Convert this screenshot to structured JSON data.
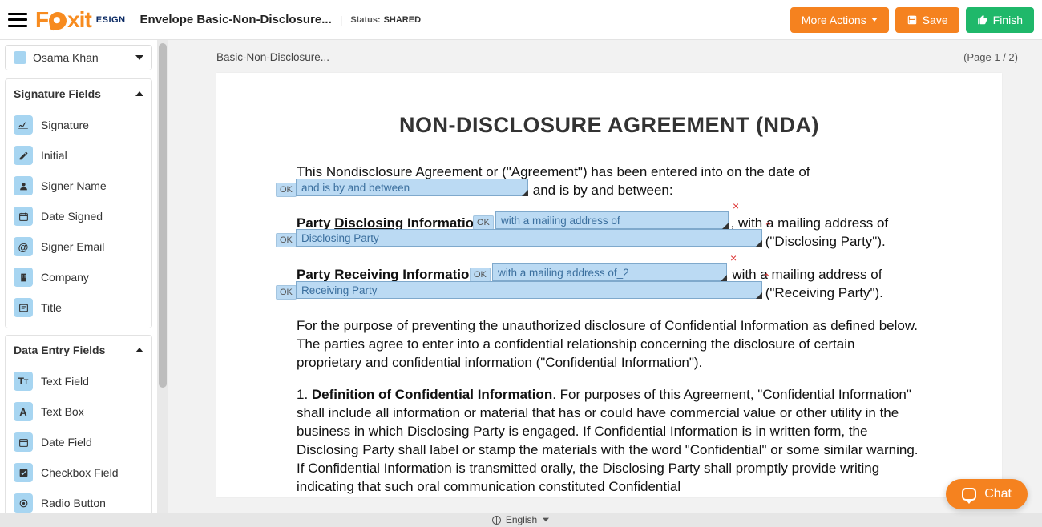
{
  "header": {
    "brand_main": "Foxit",
    "brand_sub": "ESIGN",
    "envelope_title": "Envelope Basic-Non-Disclosure...",
    "status_label": "Status:",
    "status_value": "SHARED",
    "more_actions": "More Actions",
    "save": "Save",
    "finish": "Finish"
  },
  "signer": {
    "name": "Osama Khan"
  },
  "panels": {
    "signature": {
      "title": "Signature Fields",
      "items": [
        {
          "label": "Signature",
          "icon": "signature-icon"
        },
        {
          "label": "Initial",
          "icon": "pencil-icon"
        },
        {
          "label": "Signer Name",
          "icon": "person-icon"
        },
        {
          "label": "Date Signed",
          "icon": "calendar-icon"
        },
        {
          "label": "Signer Email",
          "icon": "at-icon"
        },
        {
          "label": "Company",
          "icon": "building-icon"
        },
        {
          "label": "Title",
          "icon": "title-icon"
        }
      ]
    },
    "data_entry": {
      "title": "Data Entry Fields",
      "items": [
        {
          "label": "Text Field",
          "icon": "textfield-icon"
        },
        {
          "label": "Text Box",
          "icon": "textbox-icon"
        },
        {
          "label": "Date Field",
          "icon": "datefield-icon"
        },
        {
          "label": "Checkbox Field",
          "icon": "checkbox-icon"
        },
        {
          "label": "Radio Button",
          "icon": "radio-icon"
        }
      ]
    }
  },
  "canvas": {
    "doc_short_name": "Basic-Non-Disclosure...",
    "page_indicator": "(Page 1 / 2)"
  },
  "document": {
    "title": "NON-DISCLOSURE AGREEMENT (NDA)",
    "intro_a": "This Nondisclosure Agreement or (\"Agreement\") has been entered into on the date of",
    "intro_b": "and is by and between:",
    "party_disc_label_a": "Party ",
    "party_disc_label_b": "Disclosing",
    "party_disc_label_c": " Information:",
    "party_disc_mail": ", with a mailing address of",
    "party_disc_tail": "(\"Disclosing Party\").",
    "party_recv_label_a": "Party ",
    "party_recv_label_b": "Receiving",
    "party_recv_label_c": " Information:",
    "party_recv_mail": ", with a mailing address of",
    "party_recv_tail": "(\"Receiving Party\").",
    "purpose": "For the purpose of preventing the unauthorized disclosure of Confidential Information as defined below. The parties agree to enter into a confidential relationship concerning the disclosure of certain proprietary and confidential information (\"Confidential Information\").",
    "def_num": "1. ",
    "def_head": "Definition of Confidential Information",
    "def_body": ". For purposes of this Agreement, \"Confidential Information\" shall include all information or material that has or could have commercial value or other utility in the business in which Disclosing Party is engaged. If Confidential Information is in written form, the Disclosing Party shall label or stamp the materials with the word \"Confidential\" or some similar warning. If Confidential Information is transmitted orally, the Disclosing Party shall promptly provide writing indicating that such oral communication constituted Confidential"
  },
  "overlays": {
    "ok": "OK",
    "f1": "and is by and between",
    "f2": "with a mailing address of",
    "f3": "Disclosing Party",
    "f4": "with a mailing address of_2",
    "f5": "Receiving Party"
  },
  "footer": {
    "language": "English"
  },
  "chat": {
    "label": "Chat"
  }
}
